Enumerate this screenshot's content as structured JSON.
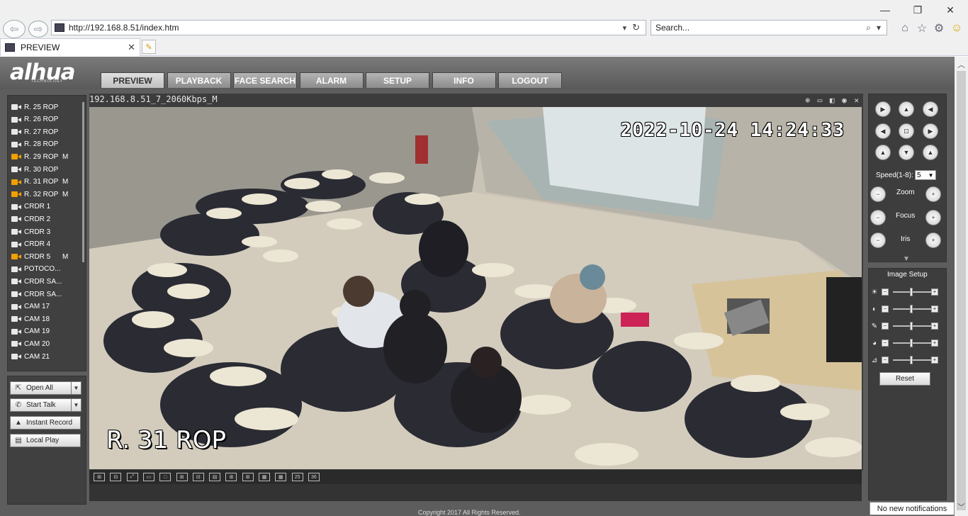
{
  "window": {
    "minimize": "—",
    "maximize": "❐",
    "close": "✕"
  },
  "address": {
    "url": "http://192.168.8.51/index.htm",
    "dropdown": "▾",
    "refresh": "↻"
  },
  "search": {
    "placeholder": "Search...",
    "icon": "⌕",
    "dropdown": "▾"
  },
  "toolbar_icons": [
    "home-icon",
    "star-icon",
    "gear-icon",
    "smiley-icon"
  ],
  "tab": {
    "title": "PREVIEW",
    "close": "✕"
  },
  "logo": {
    "text": "alhua",
    "sub": "TECHNOLOGY"
  },
  "nav": [
    "PREVIEW",
    "PLAYBACK",
    "FACE SEARCH",
    "ALARM",
    "SETUP",
    "INFO",
    "LOGOUT"
  ],
  "channels": [
    {
      "name": "R. 25 ROP",
      "on": false,
      "m": ""
    },
    {
      "name": "R. 26 ROP",
      "on": false,
      "m": ""
    },
    {
      "name": "R. 27 ROP",
      "on": false,
      "m": ""
    },
    {
      "name": "R. 28 ROP",
      "on": false,
      "m": ""
    },
    {
      "name": "R. 29 ROP",
      "on": true,
      "m": "M"
    },
    {
      "name": "R. 30 ROP",
      "on": false,
      "m": ""
    },
    {
      "name": "R. 31 ROP",
      "on": true,
      "m": "M"
    },
    {
      "name": "R. 32 ROP",
      "on": true,
      "m": "M"
    },
    {
      "name": "CRDR 1",
      "on": false,
      "m": ""
    },
    {
      "name": "CRDR 2",
      "on": false,
      "m": ""
    },
    {
      "name": "CRDR 3",
      "on": false,
      "m": ""
    },
    {
      "name": "CRDR 4",
      "on": false,
      "m": ""
    },
    {
      "name": "CRDR 5",
      "on": true,
      "m": "M"
    },
    {
      "name": "POTOCO...",
      "on": false,
      "m": ""
    },
    {
      "name": "CRDR SA...",
      "on": false,
      "m": ""
    },
    {
      "name": "CRDR SA...",
      "on": false,
      "m": ""
    },
    {
      "name": "CAM 17",
      "on": false,
      "m": ""
    },
    {
      "name": "CAM 18",
      "on": false,
      "m": ""
    },
    {
      "name": "CAM 19",
      "on": false,
      "m": ""
    },
    {
      "name": "CAM 20",
      "on": false,
      "m": ""
    },
    {
      "name": "CAM 21",
      "on": false,
      "m": ""
    }
  ],
  "buttons": {
    "open_all": "Open All",
    "start_talk": "Start Talk",
    "instant_record": "Instant Record",
    "local_play": "Local Play"
  },
  "video": {
    "stream_info": "192.168.8.51_7_2060Kbps_M",
    "timestamp": "2022-10-24 14:24:33",
    "camera_name": "R. 31 ROP",
    "header_icons": "⊕ ▭ ◧ ◉ ✕"
  },
  "layouts": [
    "1x1",
    "2x2",
    "full",
    "wide",
    "1",
    "4",
    "6",
    "8",
    "9",
    "12",
    "16",
    "20",
    "25",
    "36"
  ],
  "ptz": {
    "speed_label": "Speed(1-8):",
    "speed_value": "5",
    "zoom": "Zoom",
    "focus": "Focus",
    "iris": "Iris"
  },
  "image_setup": {
    "title": "Image Setup",
    "reset": "Reset",
    "rows": [
      "brightness-icon",
      "contrast-icon",
      "saturation-icon",
      "hue-icon",
      "sharpness-icon"
    ]
  },
  "footer": {
    "copyright": "Copyright 2017 All Rights Reserved."
  },
  "notification": "No new notifications"
}
